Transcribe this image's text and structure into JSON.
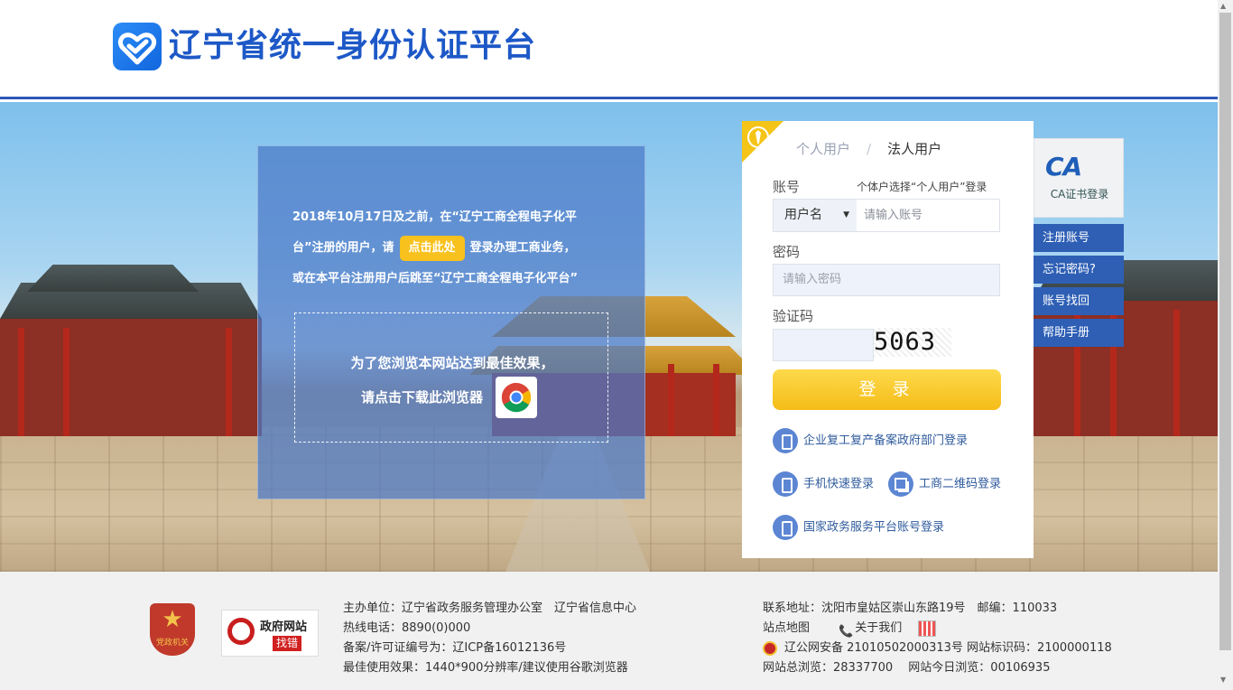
{
  "header": {
    "site_title": "辽宁省统一身份认证平台",
    "logo_icon": "heart-check-icon"
  },
  "notice": {
    "line1": "2018年10月17日及之前，在“辽宁工商全程电子化平",
    "line2_before": "台”注册的用户，请",
    "click_label": "点击此处",
    "line2_after": "登录办理工商业务，",
    "line3": "或在本平台注册用户后跳至“辽宁工商全程电子化平台”",
    "browser_line1": "为了您浏览本网站达到最佳效果，",
    "browser_line2": "请点击下载此浏览器",
    "browser_icon": "chrome-icon"
  },
  "login": {
    "tab_individual": "个人用户",
    "tab_separator": "/",
    "tab_legal": "法人用户",
    "account_label": "账号",
    "account_hint": "个体户选择“个人用户”登录",
    "account_type": "用户名",
    "account_placeholder": "请输入账号",
    "password_label": "密码",
    "password_placeholder": "请输入密码",
    "captcha_label": "验证码",
    "captcha_value": "",
    "captcha_text": "5063",
    "login_button": "登 录",
    "alt_enterprise": "企业复工复产备案政府部门登录",
    "alt_phone": "手机快速登录",
    "alt_qr": "工商二维码登录",
    "alt_national": "国家政务服务平台账号登录"
  },
  "side_menu": {
    "ca_logo": "CA",
    "ca_label": "CA证书登录",
    "register": "注册账号",
    "forgot": "忘记密码?",
    "recover": "账号找回",
    "help": "帮助手册"
  },
  "footer": {
    "party_badge": "党政机关",
    "gov_badge_title": "政府网站",
    "gov_badge_sub": "找错",
    "sponsor": "主办单位：辽宁省政务服务管理办公室　辽宁省信息中心",
    "hotline": "热线电话：8890(0)000",
    "icp": "备案/许可证编号为：辽ICP备16012136号",
    "best_view": "最佳使用效果：1440*900分辨率/建议使用谷歌浏览器",
    "address": "联系地址：沈阳市皇姑区崇山东路19号　邮编：110033",
    "sitemap": "站点地图",
    "about": "关于我们",
    "police": "辽公网安备 21010502000313号 网站标识码：2100000118",
    "visits": "网站总浏览：28337700　 网站今日浏览：00106935"
  },
  "colors": {
    "brand_blue": "#1d58c7",
    "accent_yellow": "#f5bd18",
    "side_blue": "#2e5fb5"
  }
}
